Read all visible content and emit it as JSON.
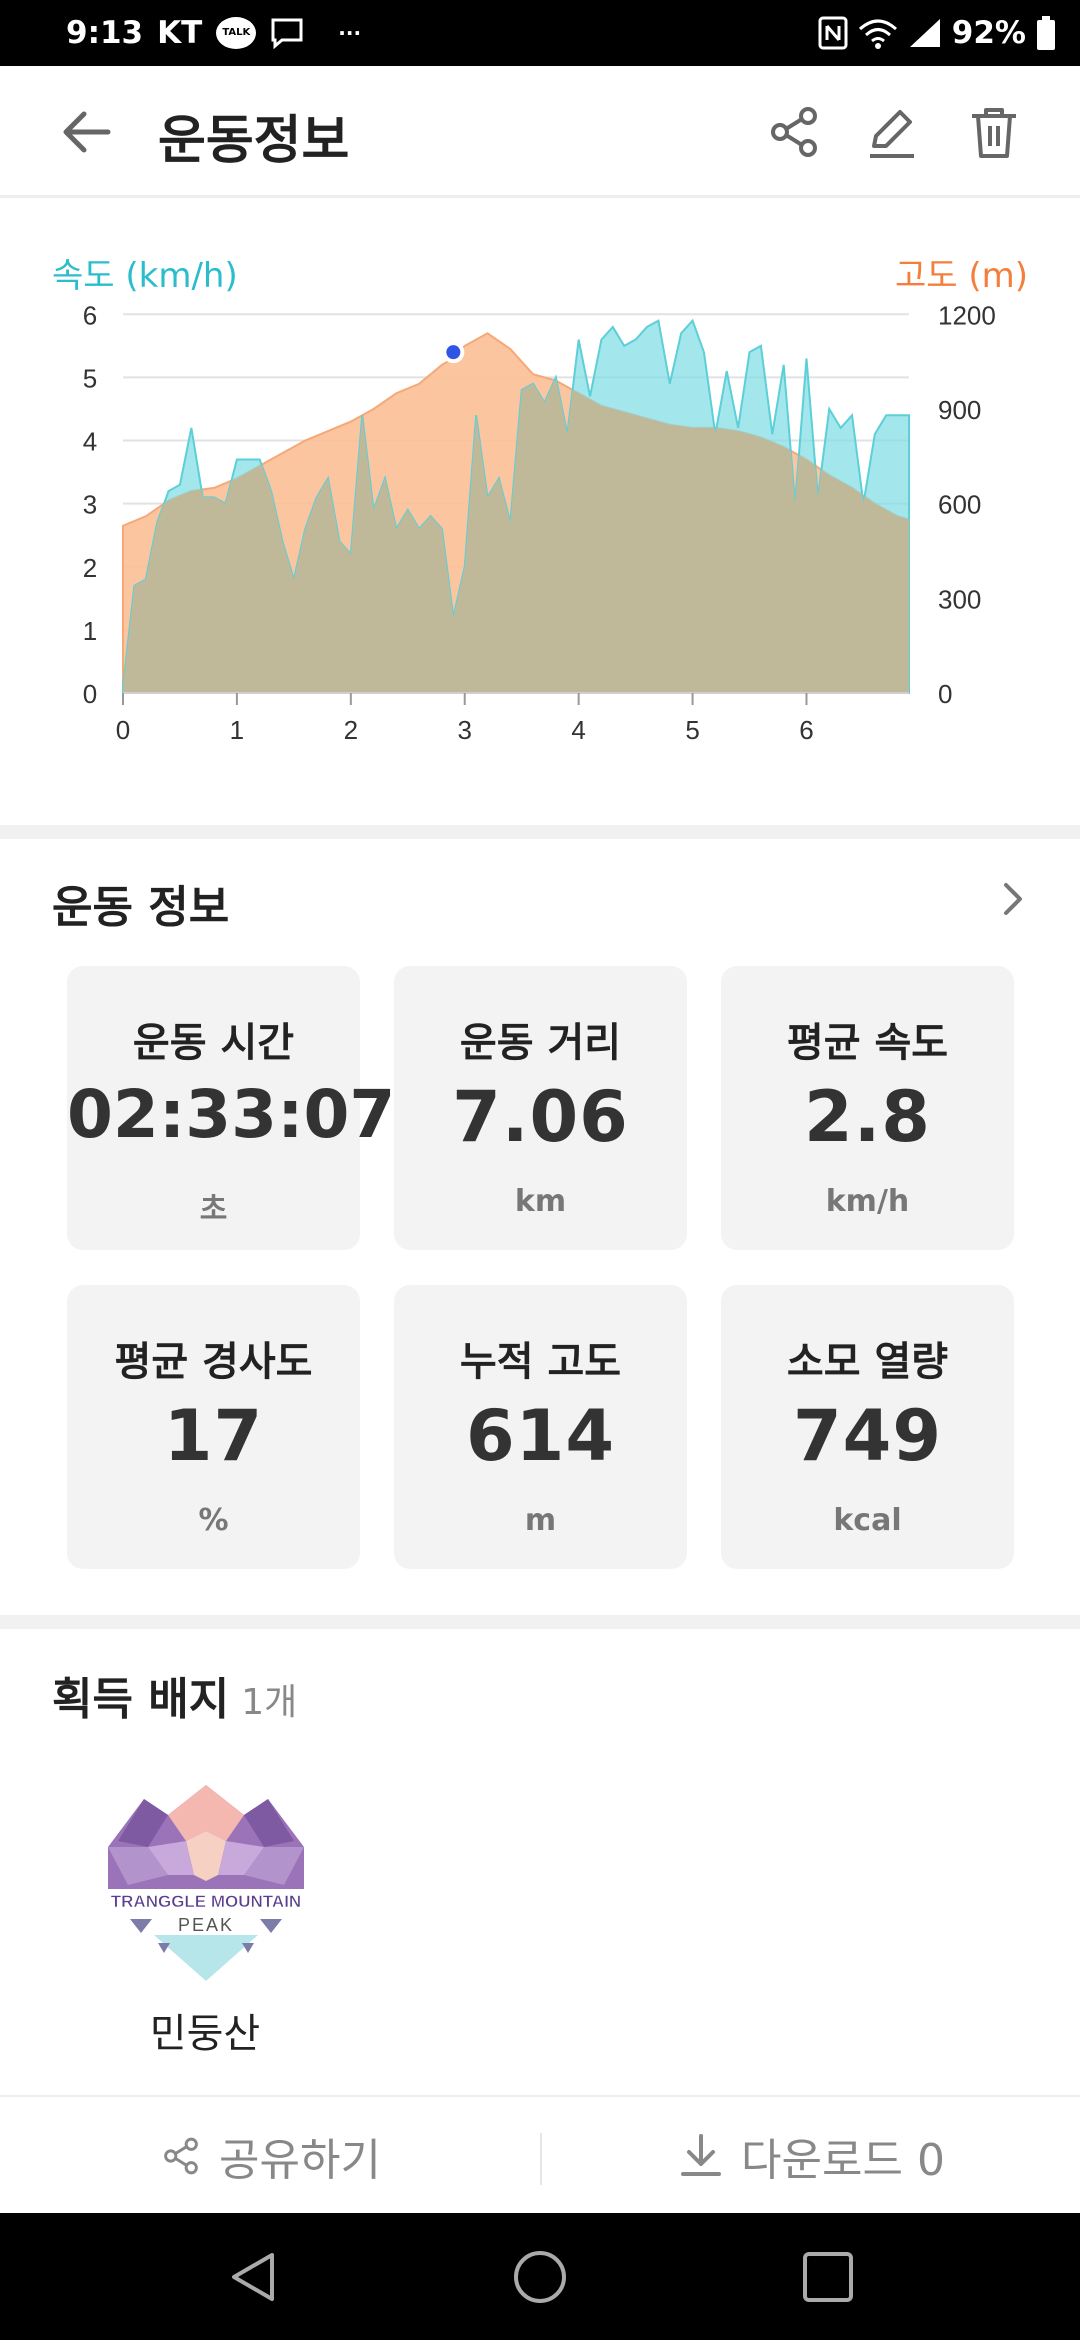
{
  "status_bar": {
    "time": "9:13",
    "carrier": "KT",
    "talk": "TALK",
    "more": "···",
    "battery": "92%"
  },
  "app_bar": {
    "title": "운동정보",
    "icons": [
      "back-arrow-icon",
      "share-icon",
      "edit-pencil-icon",
      "trash-icon"
    ]
  },
  "chart_data": {
    "type": "area",
    "left_axis_label": "속도 (km/h)",
    "right_axis_label": "고도 (m)",
    "colors": {
      "speed": "#7fdde3",
      "altitude": "#fbbf96",
      "overlap": "#bfb99a",
      "marker": "#2f55e6"
    },
    "x_ticks": [
      "0",
      "1",
      "2",
      "3",
      "4",
      "5",
      "6"
    ],
    "y_left_ticks": [
      "0",
      "1",
      "2",
      "3",
      "4",
      "5",
      "6"
    ],
    "y_right_ticks": [
      "0",
      "300",
      "600",
      "900",
      "1200"
    ],
    "xlim": [
      0,
      6.9
    ],
    "ylim_left": [
      0,
      6.1
    ],
    "ylim_right": [
      0,
      1220
    ],
    "grid": true,
    "series": [
      {
        "name": "속도 (km/h)",
        "axis": "left",
        "x": [
          0,
          0.1,
          0.2,
          0.3,
          0.4,
          0.5,
          0.6,
          0.7,
          0.8,
          0.9,
          1.0,
          1.1,
          1.2,
          1.3,
          1.4,
          1.5,
          1.6,
          1.7,
          1.8,
          1.9,
          2.0,
          2.1,
          2.2,
          2.3,
          2.4,
          2.5,
          2.6,
          2.7,
          2.8,
          2.9,
          3.0,
          3.1,
          3.2,
          3.3,
          3.4,
          3.5,
          3.6,
          3.7,
          3.8,
          3.9,
          4.0,
          4.1,
          4.2,
          4.3,
          4.4,
          4.5,
          4.6,
          4.7,
          4.8,
          4.9,
          5.0,
          5.1,
          5.2,
          5.3,
          5.4,
          5.5,
          5.6,
          5.7,
          5.8,
          5.9,
          6.0,
          6.1,
          6.2,
          6.3,
          6.4,
          6.5,
          6.6,
          6.7,
          6.8,
          6.9
        ],
        "values": [
          0.1,
          1.7,
          1.8,
          2.7,
          3.2,
          3.3,
          4.2,
          3.1,
          3.1,
          3.0,
          3.7,
          3.7,
          3.7,
          3.2,
          2.4,
          1.8,
          2.6,
          3.1,
          3.4,
          2.4,
          2.2,
          4.4,
          2.9,
          3.4,
          2.6,
          2.9,
          2.6,
          2.8,
          2.6,
          1.2,
          2.0,
          4.4,
          3.1,
          3.4,
          2.7,
          4.8,
          4.9,
          4.6,
          5.0,
          4.1,
          5.6,
          4.7,
          5.6,
          5.8,
          5.5,
          5.6,
          5.8,
          5.9,
          4.9,
          5.7,
          5.9,
          5.4,
          4.1,
          5.1,
          4.2,
          5.4,
          5.5,
          4.1,
          5.2,
          3.0,
          5.3,
          3.1,
          4.5,
          4.2,
          4.4,
          3.0,
          4.1,
          4.4,
          4.4,
          4.4
        ]
      },
      {
        "name": "고도 (m)",
        "axis": "right",
        "x": [
          0,
          0.2,
          0.4,
          0.6,
          0.8,
          1.0,
          1.2,
          1.4,
          1.6,
          1.8,
          2.0,
          2.2,
          2.4,
          2.6,
          2.8,
          2.9,
          3.0,
          3.2,
          3.4,
          3.6,
          3.8,
          4.0,
          4.2,
          4.4,
          4.6,
          4.8,
          5.0,
          5.2,
          5.4,
          5.6,
          5.8,
          6.0,
          6.2,
          6.4,
          6.6,
          6.8,
          6.9
        ],
        "values": [
          530,
          560,
          610,
          640,
          650,
          680,
          720,
          760,
          800,
          830,
          860,
          900,
          950,
          980,
          1040,
          1060,
          1100,
          1140,
          1090,
          1010,
          990,
          950,
          910,
          890,
          870,
          850,
          840,
          840,
          830,
          810,
          780,
          740,
          690,
          650,
          600,
          560,
          550
        ]
      }
    ],
    "marker_point": {
      "x": 2.9,
      "altitude": 1080
    }
  },
  "info_section": {
    "title": "운동 정보",
    "cards": [
      {
        "label": "운동 시간",
        "value": "02:33:07",
        "unit": "초"
      },
      {
        "label": "운동 거리",
        "value": "7.06",
        "unit": "km"
      },
      {
        "label": "평균 속도",
        "value": "2.8",
        "unit": "km/h"
      },
      {
        "label": "평균 경사도",
        "value": "17",
        "unit": "%"
      },
      {
        "label": "누적 고도",
        "value": "614",
        "unit": "m"
      },
      {
        "label": "소모 열량",
        "value": "749",
        "unit": "kcal"
      }
    ]
  },
  "badge_section": {
    "title": "획득 배지",
    "count": "1개",
    "badge": {
      "logo_text_1": "TRANGGLE MOUNTAIN",
      "logo_text_2": "PEAK",
      "name": "민둥산"
    }
  },
  "bottom_bar": {
    "share_label": "공유하기",
    "download_label": "다운로드 0"
  }
}
